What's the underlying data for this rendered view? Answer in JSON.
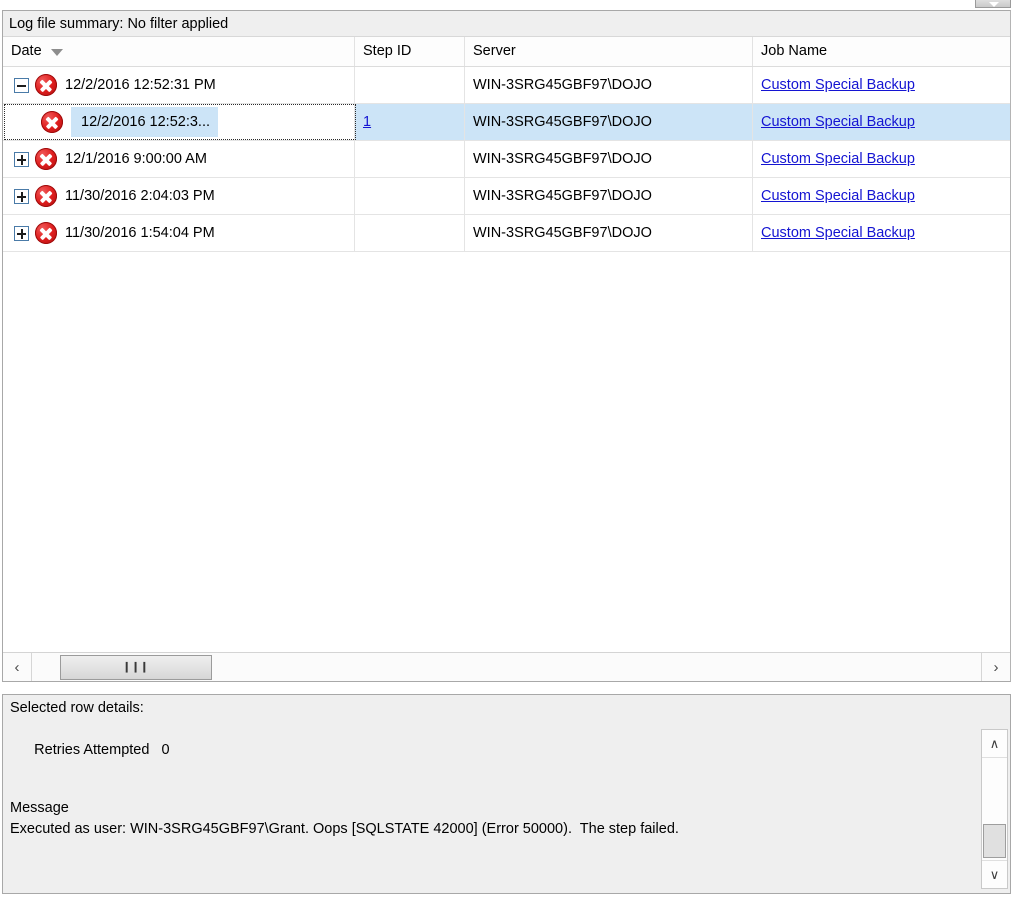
{
  "window": {
    "top_widget_icon": "dropdown-caret-icon"
  },
  "grid": {
    "summary_label": "Log file summary: No filter applied",
    "columns": [
      {
        "key": "date",
        "label": "Date",
        "filter_icon": "funnel-icon"
      },
      {
        "key": "step",
        "label": "Step ID"
      },
      {
        "key": "server",
        "label": "Server"
      },
      {
        "key": "job",
        "label": "Job Name"
      }
    ],
    "rows": [
      {
        "level": 0,
        "expander": "minus",
        "status_icon": "error-icon",
        "date": "12/2/2016 12:52:31 PM",
        "step_id": "",
        "server": "WIN-3SRG45GBF97\\DOJO",
        "job_name": "Custom Special Backup",
        "selected": false
      },
      {
        "level": 1,
        "expander": "none",
        "status_icon": "error-icon",
        "date": "12/2/2016 12:52:3...",
        "step_id": "1",
        "server": "WIN-3SRG45GBF97\\DOJO",
        "job_name": "Custom Special Backup",
        "selected": true
      },
      {
        "level": 0,
        "expander": "plus",
        "status_icon": "error-icon",
        "date": "12/1/2016 9:00:00 AM",
        "step_id": "",
        "server": "WIN-3SRG45GBF97\\DOJO",
        "job_name": "Custom Special Backup",
        "selected": false
      },
      {
        "level": 0,
        "expander": "plus",
        "status_icon": "error-icon",
        "date": "11/30/2016 2:04:03 PM",
        "step_id": "",
        "server": "WIN-3SRG45GBF97\\DOJO",
        "job_name": "Custom Special Backup",
        "selected": false
      },
      {
        "level": 0,
        "expander": "plus",
        "status_icon": "error-icon",
        "date": "11/30/2016 1:54:04 PM",
        "step_id": "",
        "server": "WIN-3SRG45GBF97\\DOJO",
        "job_name": "Custom Special Backup",
        "selected": false
      }
    ],
    "hscrollbar": {
      "left_arrow": "‹",
      "right_arrow": "›",
      "thumb_grip": "❙❙❙"
    }
  },
  "details": {
    "title": "Selected row details:",
    "retries_label": "Retries Attempted",
    "retries_value": "0",
    "message_label": "Message",
    "message_text": "Executed as user: WIN-3SRG45GBF97\\Grant. Oops [SQLSTATE 42000] (Error 50000).  The step failed.",
    "vscrollbar": {
      "up_arrow": "∧",
      "down_arrow": "∨"
    }
  },
  "colors": {
    "selection": "#cce4f7",
    "link": "#1414d2",
    "error": "#e02020",
    "panel_bg": "#efefef",
    "border": "#a8a8a8"
  }
}
